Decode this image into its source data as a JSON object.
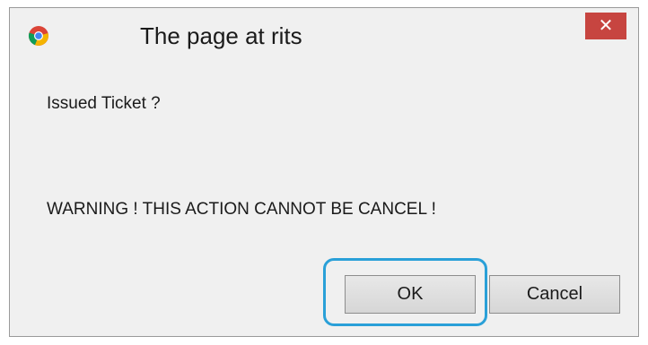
{
  "dialog": {
    "title": "The page at rits",
    "close_label": "✕",
    "message_line_1": "Issued Ticket ?",
    "message_line_2": "WARNING ! THIS ACTION CANNOT BE CANCEL !",
    "ok_label": "OK",
    "cancel_label": "Cancel",
    "app_icon": "chrome-icon",
    "colors": {
      "close_button": "#c74540",
      "focus_ring": "#2aa0d8",
      "background": "#f0f0f0"
    }
  }
}
